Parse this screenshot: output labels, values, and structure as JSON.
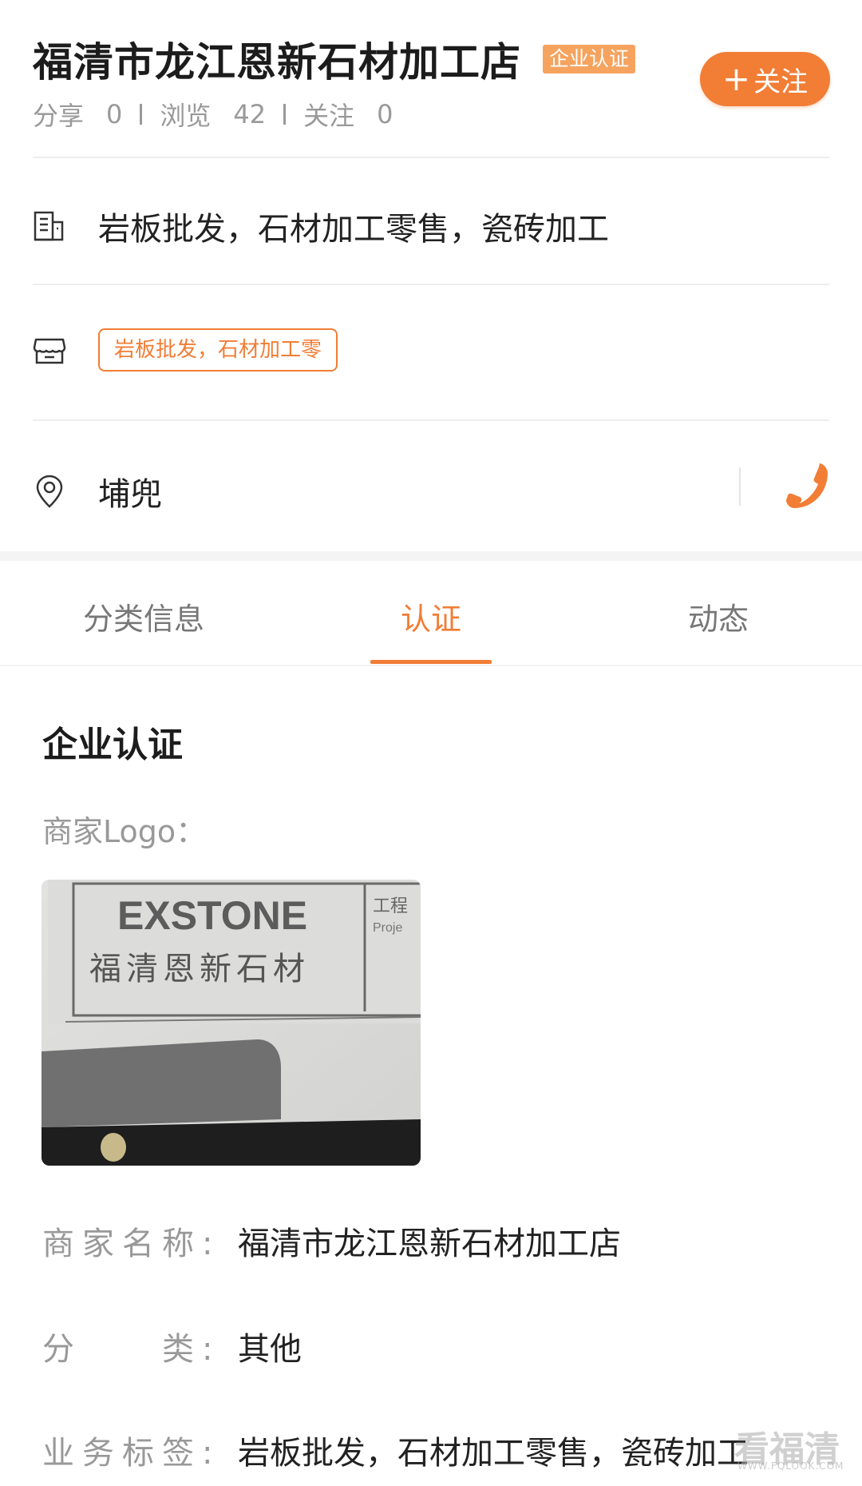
{
  "shop": {
    "name": "福清市龙江恩新石材加工店",
    "badge": "企业认证",
    "follow_label": "关注"
  },
  "stats": {
    "share_label": "分享",
    "share_count": "0",
    "view_label": "浏览",
    "view_count": "42",
    "follow_label": "关注",
    "follow_count": "0"
  },
  "business": {
    "icon": "building-icon",
    "text": "岩板批发，石材加工零售，瓷砖加工"
  },
  "tag_row": {
    "icon": "store-icon",
    "tag": "岩板批发，石材加工零"
  },
  "location": {
    "icon": "location-pin-icon",
    "text": "埔兜",
    "phone_icon": "phone-icon"
  },
  "tabs": [
    {
      "label": "分类信息",
      "active": false
    },
    {
      "label": "认证",
      "active": true
    },
    {
      "label": "动态",
      "active": false
    }
  ],
  "certification": {
    "title": "企业认证",
    "logo_label": "商家Logo：",
    "logo_image_text": {
      "brand": "EXSTONE",
      "chinese": "福清恩新石材",
      "side_cn": "工程",
      "side_en": "Proje"
    },
    "fields": [
      {
        "label": "商家名称:",
        "value": "福清市龙江恩新石材加工店"
      },
      {
        "label": "分　　类:",
        "value": "其他"
      },
      {
        "label": "业务标签:",
        "value": "岩板批发，石材加工零售，瓷砖加工"
      }
    ]
  },
  "watermark": {
    "text": "看福清",
    "sub": "WWW.FQLOOK.COM"
  },
  "colors": {
    "accent": "#f27d35",
    "badge": "#f5a35e"
  }
}
